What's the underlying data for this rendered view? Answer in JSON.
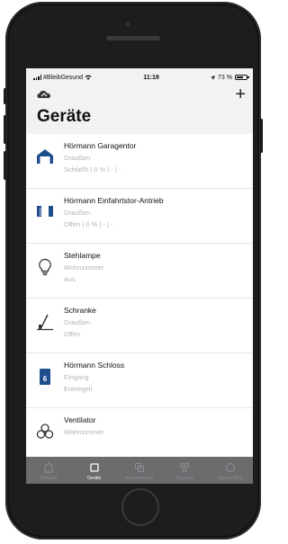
{
  "status_bar": {
    "carrier": "#BleibGesund",
    "time": "11:19",
    "battery": "73 %",
    "battery_level": 0.73
  },
  "nav": {
    "add_label": "+"
  },
  "page": {
    "title": "Geräte"
  },
  "devices": [
    {
      "name": "Hörmann Garagentor",
      "room": "Draußen",
      "status": "Schließt | 0 % | - | -",
      "icon": "garage-icon"
    },
    {
      "name": "Hörmann Einfahrtstor-Antrieb",
      "room": "Draußen",
      "status": "Offen | 0 % | - | -",
      "icon": "gate-icon"
    },
    {
      "name": "Stehlampe",
      "room": "Wohnzimmer",
      "status": "Aus",
      "icon": "lightbulb-icon"
    },
    {
      "name": "Schranke",
      "room": "Draußen",
      "status": "Offen",
      "icon": "barrier-icon"
    },
    {
      "name": "Hörmann Schloss",
      "room": "Eingang",
      "status": "Entriegelt",
      "icon": "lock-icon"
    },
    {
      "name": "Ventilator",
      "room": "Wohnzimmer",
      "status": "",
      "icon": "fan-icon"
    }
  ],
  "tabs": [
    {
      "label": "Zuhause",
      "active": false
    },
    {
      "label": "Geräte",
      "active": true
    },
    {
      "label": "Automationen",
      "active": false
    },
    {
      "label": "Gruppen",
      "active": false
    },
    {
      "label": "homee Welt",
      "active": false
    }
  ],
  "colors": {
    "accent": "#1f4e8c",
    "tabbar": "#6c6c6f"
  }
}
